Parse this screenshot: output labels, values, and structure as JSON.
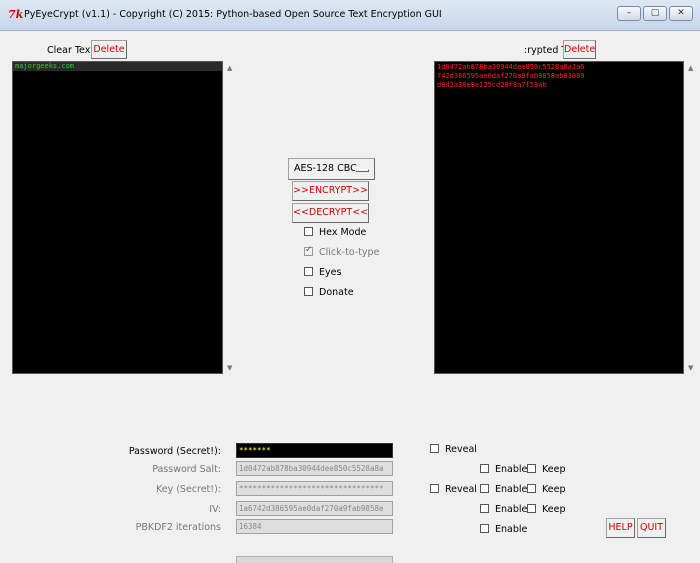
{
  "window": {
    "title": "PyEyeCrypt (v1.1)  -  Copyright (C) 2015:  Python-based Open Source Text Encryption GUI",
    "logo": "7k",
    "controls": [
      "–",
      "▢",
      "✕"
    ]
  },
  "left_panel": {
    "label": "Clear Text",
    "delete_label": "Delete",
    "text": "majorgeeks.com",
    "text_color": "#32cd32"
  },
  "right_panel": {
    "label": ":rypted T",
    "delete_label": "Delete",
    "text": "1d0472ab878ba30944dee850c5528a8a1a6742d386595ae0daf270a9fab9858ab83089d8d2a38e8e125cd28f8a7f53ab",
    "text_color": "#ff2222"
  },
  "center": {
    "cipher": "AES-128 CBC",
    "encrypt_label": ">>ENCRYPT>>",
    "decrypt_label": "<<DECRYPT<<",
    "options": [
      {
        "label": "Hex Mode",
        "checked": false,
        "disabled": false
      },
      {
        "label": "Click-to-type",
        "checked": true,
        "disabled": true
      },
      {
        "label": "Eyes",
        "checked": false,
        "disabled": false
      },
      {
        "label": "Donate",
        "checked": false,
        "disabled": false
      }
    ]
  },
  "form": {
    "password_label": "Password (Secret!):",
    "password_value": "*******",
    "salt_label": "Password Salt:",
    "salt_value": "1d0472ab878ba30944dee850c5528a8a",
    "key_label": "Key (Secret!):",
    "key_value": "********************************",
    "iv_label": "IV:",
    "iv_value": "1a6742d386595ae0daf270a9fab9858e",
    "pbkdf2_label": "PBKDF2 iterations",
    "pbkdf2_value": "16384",
    "reveal_label": "Reveal",
    "enable_label": "Enable",
    "keep_label": "Keep"
  },
  "buttons": {
    "help": "HELP",
    "quit": "QUIT"
  }
}
